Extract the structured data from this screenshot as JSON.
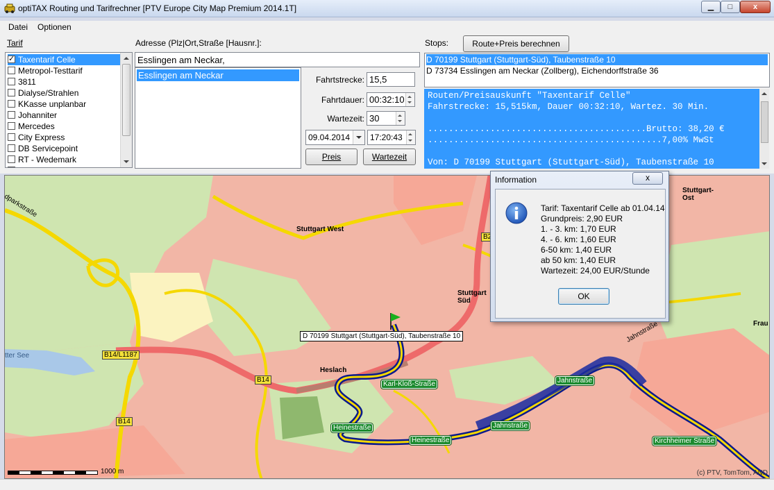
{
  "window": {
    "title": "optiTAX Routing und Tarifrechner [PTV Europe City Map Premium 2014.1T]",
    "minimize_glyph": "▁",
    "maximize_glyph": "□",
    "close_glyph": "x"
  },
  "menu": {
    "items": [
      "Datei",
      "Optionen"
    ]
  },
  "tarif": {
    "label": "Tarif",
    "items": [
      {
        "label": "Taxentarif Celle",
        "checked": true,
        "selected": true
      },
      {
        "label": "Metropol-Testtarif",
        "checked": false
      },
      {
        "label": "3811",
        "checked": false
      },
      {
        "label": "Dialyse/Strahlen",
        "checked": false
      },
      {
        "label": "KKasse unplanbar",
        "checked": false
      },
      {
        "label": "Johanniter",
        "checked": false
      },
      {
        "label": "Mercedes",
        "checked": false
      },
      {
        "label": "City Express",
        "checked": false
      },
      {
        "label": "DB Servicepoint",
        "checked": false
      },
      {
        "label": "RT - Wedemark",
        "checked": false
      },
      {
        "label": "Dialyse",
        "checked": false
      }
    ]
  },
  "address": {
    "label": "Adresse (Plz|Ort,Straße [Hausnr.]:",
    "input_value": "Esslingen am Neckar,",
    "suggestion": "Esslingen am Neckar"
  },
  "fields": {
    "fahrtstrecke_label": "Fahrtstrecke:",
    "fahrtstrecke_value": "15,5",
    "fahrtdauer_label": "Fahrtdauer:",
    "fahrtdauer_value": "00:32:10",
    "wartezeit_label": "Wartezeit:",
    "wartezeit_value": "30",
    "date_value": "09.04.2014",
    "time_value": "17:20:43",
    "preis_button": "Preis",
    "wartezeit_button": "Wartezeit"
  },
  "stops": {
    "label": "Stops:",
    "route_button": "Route+Preis berechnen",
    "items": [
      "D 70199 Stuttgart (Stuttgart-Süd), Taubenstraße 10",
      "D 73734 Esslingen am Neckar (Zollberg), Eichendorffstraße 36"
    ]
  },
  "result": {
    "lines": [
      "Routen/Preisauskunft \"Taxentarif Celle\"",
      "Fahrstrecke: 15,515km, Dauer 00:32:10, Wartez. 30 Min.",
      "",
      "..........................................Brutto: 38,20 €",
      ".............................................7,00% MwSt",
      "",
      "Von: D 70199 Stuttgart (Stuttgart-Süd), Taubenstraße 10"
    ]
  },
  "map": {
    "places": [
      "Stuttgart West",
      "Stuttgart Süd",
      "Stuttgart-Ost",
      "Heslach",
      "Frau"
    ],
    "roads": [
      "B14/L1187",
      "B14",
      "B14",
      "B2"
    ],
    "streets": [
      "Karl-Kloß-Straße",
      "Jahnstraße",
      "Heinestraße",
      "Heinestraße",
      "Jahnstraße",
      "Kirchheimer Straße"
    ],
    "map_labels": [
      "dparkstraße",
      "tter See",
      "Jahnstraße"
    ],
    "tooltip": "D 70199 Stuttgart (Stuttgart-Süd), Taubenstraße 10",
    "scale": "1000 m",
    "copyright": "(c) PTV, TomTom, AND"
  },
  "dialog": {
    "title": "Information",
    "lines": [
      "Tarif: Taxentarif Celle ab 01.04.14",
      "Grundpreis: 2,90 EUR",
      "1. - 3. km: 1,70 EUR",
      "4. - 6. km: 1,60 EUR",
      "6-50 km: 1,40 EUR",
      "ab 50 km: 1,40 EUR",
      "Wartezeit: 24,00 EUR/Stunde"
    ],
    "ok_button": "OK",
    "close_glyph": "x"
  },
  "colors": {
    "selection": "#3399ff",
    "route": "#0a1a8c",
    "street_label": "#1b8a2e"
  }
}
